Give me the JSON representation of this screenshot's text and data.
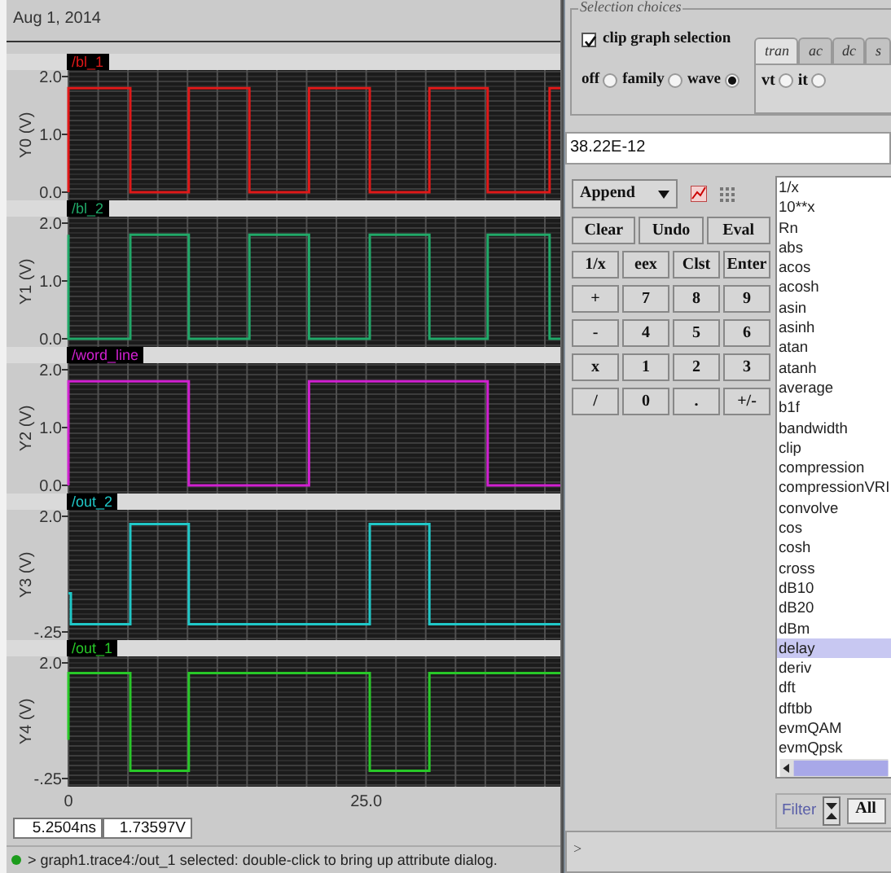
{
  "header": {
    "date": "Aug 1, 2014"
  },
  "plots": [
    {
      "chart_data": {
        "type": "line",
        "ylabel": "Y0 (V)",
        "xlim": [
          0,
          41.3
        ],
        "ylim": [
          0,
          2
        ],
        "yticks": [
          {
            "value": 0,
            "label": "0.0"
          },
          {
            "value": 1,
            "label": "1.0"
          },
          {
            "value": 2,
            "label": "2.0"
          }
        ],
        "x": [
          0,
          0,
          5.2,
          5.2,
          10.1,
          10.1,
          15.2,
          15.2,
          20.2,
          20.2,
          25.3,
          25.3,
          30.3,
          30.3,
          35.2,
          35.2,
          40.4,
          40.4,
          41.3
        ],
        "series": [
          {
            "name": "/bl_1",
            "color": "#e01818",
            "values": [
              0,
              1.8,
              1.8,
              0,
              0,
              1.8,
              1.8,
              0,
              0,
              1.8,
              1.8,
              0,
              0,
              1.8,
              1.8,
              0,
              0,
              1.8,
              1.8
            ]
          }
        ]
      }
    },
    {
      "chart_data": {
        "type": "line",
        "ylabel": "Y1 (V)",
        "xlim": [
          0,
          41.3
        ],
        "ylim": [
          0,
          2
        ],
        "yticks": [
          {
            "value": 0,
            "label": "0.0"
          },
          {
            "value": 1,
            "label": "1.0"
          },
          {
            "value": 2,
            "label": "2.0"
          }
        ],
        "x": [
          0,
          0,
          5.2,
          5.2,
          10.1,
          10.1,
          15.2,
          15.2,
          20.2,
          20.2,
          25.3,
          25.3,
          30.3,
          30.3,
          35.2,
          35.2,
          40.4,
          40.4,
          41.3
        ],
        "series": [
          {
            "name": "/bl_2",
            "color": "#20a868",
            "values": [
              1.8,
              0,
              0,
              1.8,
              1.8,
              0,
              0,
              1.8,
              1.8,
              0,
              0,
              1.8,
              1.8,
              0,
              0,
              1.8,
              1.8,
              0,
              0
            ]
          }
        ]
      }
    },
    {
      "chart_data": {
        "type": "line",
        "ylabel": "Y2 (V)",
        "xlim": [
          0,
          41.3
        ],
        "ylim": [
          0,
          2
        ],
        "yticks": [
          {
            "value": 0,
            "label": "0.0"
          },
          {
            "value": 1,
            "label": "1.0"
          },
          {
            "value": 2,
            "label": "2.0"
          }
        ],
        "x": [
          0,
          0,
          10.1,
          10.1,
          20.2,
          20.2,
          35.2,
          35.2,
          41.3
        ],
        "series": [
          {
            "name": "/word_line",
            "color": "#d020d0",
            "values": [
              0,
              1.8,
              1.8,
              0,
              0,
              1.8,
              1.8,
              0,
              0
            ]
          }
        ]
      }
    },
    {
      "chart_data": {
        "type": "line",
        "ylabel": "Y3 (V)",
        "xlim": [
          0,
          41.3
        ],
        "ylim": [
          -0.25,
          2
        ],
        "yticks": [
          {
            "value": -0.25,
            "label": "-.25"
          },
          {
            "value": 2,
            "label": "2.0"
          }
        ],
        "x": [
          0,
          0.2,
          0.2,
          5.2,
          5.2,
          10.1,
          10.1,
          25.3,
          25.3,
          30.3,
          30.3,
          41.3
        ],
        "series": [
          {
            "name": "/out_2",
            "color": "#20c8c8",
            "values": [
              0.5,
              0.5,
              -0.1,
              -0.1,
              1.85,
              1.85,
              -0.1,
              -0.1,
              1.85,
              1.85,
              -0.1,
              -0.1
            ]
          }
        ]
      }
    },
    {
      "chart_data": {
        "type": "line",
        "ylabel": "Y4 (V)",
        "xlim": [
          0,
          41.3
        ],
        "ylim": [
          -0.25,
          2
        ],
        "yticks": [
          {
            "value": -0.25,
            "label": "-.25"
          },
          {
            "value": 2,
            "label": "2.0"
          }
        ],
        "xticks": [
          {
            "value": 0,
            "label": "0"
          },
          {
            "value": 25,
            "label": "25.0"
          }
        ],
        "x": [
          0,
          0,
          5.2,
          5.2,
          10.1,
          10.1,
          25.3,
          25.3,
          30.3,
          30.3,
          41.3
        ],
        "series": [
          {
            "name": "/out_1",
            "color": "#28c828",
            "values": [
              0.5,
              1.8,
              1.8,
              -0.1,
              -0.1,
              1.8,
              1.8,
              -0.1,
              -0.1,
              1.8,
              1.8
            ]
          }
        ]
      }
    }
  ],
  "readout": {
    "time": "5.2504ns",
    "value": "1.73597V"
  },
  "status_bar": {
    "text": "> graph1.trace4:/out_1 selected: double-click to bring up attribute dialog."
  },
  "selection": {
    "title": "Selection choices",
    "clip": {
      "label": "clip graph selection",
      "checked": true
    },
    "modes": [
      {
        "label": "off",
        "selected": false
      },
      {
        "label": "family",
        "selected": false
      },
      {
        "label": "wave",
        "selected": true
      }
    ],
    "analysis_tabs": [
      {
        "label": "tran",
        "selected": true
      },
      {
        "label": "ac",
        "selected": false
      },
      {
        "label": "dc",
        "selected": false
      },
      {
        "label": "s",
        "selected": false
      }
    ],
    "signal_types": [
      {
        "label": "vt",
        "selected": false
      },
      {
        "label": "it",
        "selected": false
      }
    ]
  },
  "expression": "38.22E-12",
  "calculator": {
    "mode": "Append",
    "edit_buttons": [
      "Clear",
      "Undo",
      "Eval"
    ],
    "keypad": [
      [
        "1/x",
        "eex",
        "Clst",
        "Enter"
      ],
      [
        "+",
        "7",
        "8",
        "9"
      ],
      [
        "-",
        "4",
        "5",
        "6"
      ],
      [
        "x",
        "1",
        "2",
        "3"
      ],
      [
        "/",
        "0",
        ".",
        "+/-"
      ]
    ]
  },
  "functions": [
    {
      "label": "1/x",
      "selected": false
    },
    {
      "label": "10**x",
      "selected": false
    },
    {
      "label": "Rn",
      "selected": false
    },
    {
      "label": "abs",
      "selected": false
    },
    {
      "label": "acos",
      "selected": false
    },
    {
      "label": "acosh",
      "selected": false
    },
    {
      "label": "asin",
      "selected": false
    },
    {
      "label": "asinh",
      "selected": false
    },
    {
      "label": "atan",
      "selected": false
    },
    {
      "label": "atanh",
      "selected": false
    },
    {
      "label": "average",
      "selected": false
    },
    {
      "label": "b1f",
      "selected": false
    },
    {
      "label": "bandwidth",
      "selected": false
    },
    {
      "label": "clip",
      "selected": false
    },
    {
      "label": "compression",
      "selected": false
    },
    {
      "label": "compressionVRI",
      "selected": false
    },
    {
      "label": "convolve",
      "selected": false
    },
    {
      "label": "cos",
      "selected": false
    },
    {
      "label": "cosh",
      "selected": false
    },
    {
      "label": "cross",
      "selected": false
    },
    {
      "label": "dB10",
      "selected": false
    },
    {
      "label": "dB20",
      "selected": false
    },
    {
      "label": "dBm",
      "selected": false
    },
    {
      "label": "delay",
      "selected": true
    },
    {
      "label": "deriv",
      "selected": false
    },
    {
      "label": "dft",
      "selected": false
    },
    {
      "label": "dftbb",
      "selected": false
    },
    {
      "label": "evmQAM",
      "selected": false
    },
    {
      "label": "evmQpsk",
      "selected": false
    }
  ],
  "filter": {
    "label": "Filter",
    "value": "All"
  },
  "command_line": {
    "prompt": ">"
  }
}
